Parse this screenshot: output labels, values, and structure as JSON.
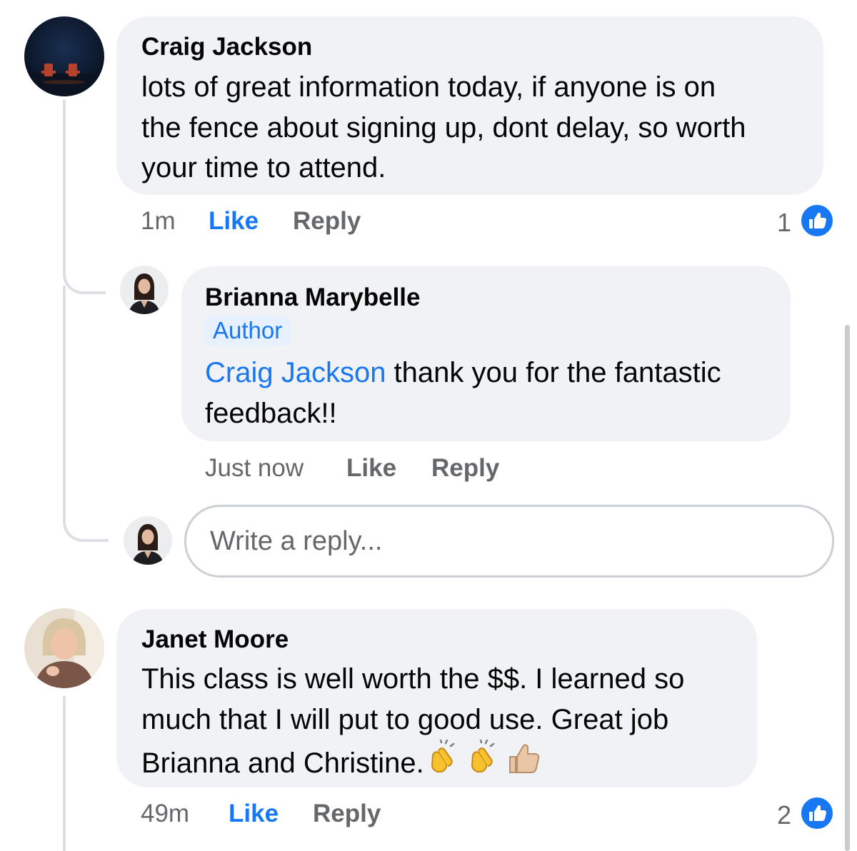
{
  "comments": [
    {
      "author": "Craig Jackson",
      "text": "lots of great information today, if anyone is on the fence about signing up, dont delay, so worth your time to attend.",
      "line1": "lots of great information today, if anyone is on",
      "line2": "the fence about signing up, dont delay, so worth",
      "line3": "your time to attend.",
      "time": "1m",
      "like_label": "Like",
      "like_state": "liked",
      "reply_label": "Reply",
      "reaction_count": "1",
      "reaction_icon": "thumbs-up-icon",
      "avatar": "beach-chairs-avatar"
    },
    {
      "author": "Janet Moore",
      "line1": "This class is well worth the $$. I learned  so",
      "line2": "much that I will put to good use. Great job",
      "line3": "Brianna and Christine.",
      "emojis": [
        "clapping-hands",
        "clapping-hands",
        "thumbs-up"
      ],
      "time": "49m",
      "like_label": "Like",
      "like_state": "liked",
      "reply_label": "Reply",
      "reaction_count": "2",
      "reaction_icon": "thumbs-up-icon",
      "avatar": "woman-photo-avatar"
    }
  ],
  "reply": {
    "author": "Brianna Marybelle",
    "badge": "Author",
    "mention": "Craig Jackson",
    "line1_rest": " thank you for the fantastic",
    "line2": "feedback!!",
    "time": "Just now",
    "like_label": "Like",
    "reply_label": "Reply",
    "avatar": "woman-photo-avatar"
  },
  "reply_box": {
    "placeholder": "Write a reply..."
  },
  "colors": {
    "accent": "#1877f2",
    "bubble": "#f0f2f5",
    "muted": "#65676b"
  }
}
